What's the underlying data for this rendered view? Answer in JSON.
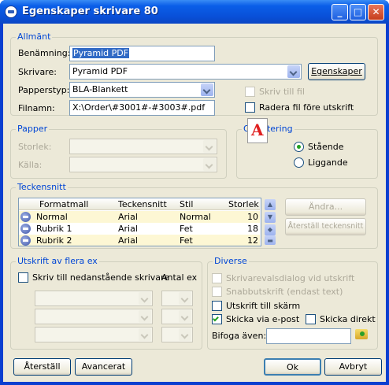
{
  "window": {
    "title": "Egenskaper skrivare 80"
  },
  "general": {
    "group_label": "Allmänt",
    "name_label": "Benämning:",
    "name_value": "Pyramid PDF",
    "printer_label": "Skrivare:",
    "printer_value": "Pyramid PDF",
    "properties_button": "Egenskaper",
    "papertype_label": "Papperstyp:",
    "papertype_value": "BLA-Blankett",
    "print_to_file": "Skriv till fil",
    "filename_label": "Filnamn:",
    "filename_value": "X:\\Order\\#3001#-#3003#.pdf",
    "delete_file": "Radera fil före utskrift"
  },
  "paper": {
    "group_label": "Papper",
    "size_label": "Storlek:",
    "source_label": "Källa:"
  },
  "orientation": {
    "group_label": "Orientering",
    "icon_letter": "A",
    "portrait": "Stående",
    "landscape": "Liggande",
    "selected": "portrait"
  },
  "fonts": {
    "group_label": "Teckensnitt",
    "columns": [
      "Formatmall",
      "Teckensnitt",
      "Stil",
      "Storlek"
    ],
    "rows": [
      {
        "style_name": "Normal",
        "font": "Arial",
        "style": "Normal",
        "size": "10"
      },
      {
        "style_name": "Rubrik 1",
        "font": "Arial",
        "style": "Fet",
        "size": "18"
      },
      {
        "style_name": "Rubrik 2",
        "font": "Arial",
        "style": "Fet",
        "size": "12"
      }
    ],
    "change_button": "Ändra...",
    "reset_button": "Återställ teckensnitt"
  },
  "multi": {
    "group_label": "Utskrift av flera ex",
    "print_to_below": "Skriv till nedanstående skrivare",
    "copies_label": "Antal ex"
  },
  "misc": {
    "group_label": "Diverse",
    "dialog": "Skrivarevalsdialog vid utskrift",
    "quick": "Snabbutskrift (endast text)",
    "to_screen": "Utskrift till skärm",
    "via_email": "Skicka via e-post",
    "send_direct": "Skicka direkt",
    "attach_label": "Bifoga även:"
  },
  "footer": {
    "reset": "Återställ",
    "advanced": "Avancerat",
    "ok": "Ok",
    "cancel": "Avbryt"
  }
}
